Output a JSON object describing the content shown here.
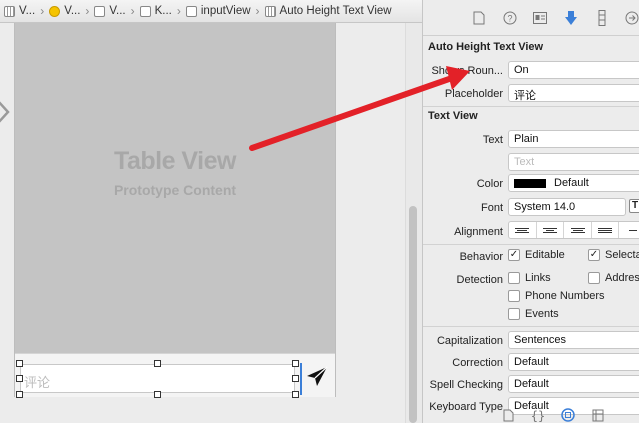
{
  "breadcrumbs": [
    {
      "label": "V...",
      "icon": "file-icon"
    },
    {
      "label": "V...",
      "icon": "yellow-circle-icon"
    },
    {
      "label": "V...",
      "icon": "view-icon"
    },
    {
      "label": "K...",
      "icon": "view-icon"
    },
    {
      "label": "inputView",
      "icon": "view-icon"
    },
    {
      "label": "Auto Height Text View",
      "icon": "textview-icon"
    }
  ],
  "canvas": {
    "table_title": "Table View",
    "table_subtitle": "Prototype Content",
    "input_placeholder": "评论"
  },
  "inspector": {
    "section1": {
      "title": "Auto Height Text View",
      "shows_round_label": "Shows Roun...",
      "shows_round_value": "On",
      "placeholder_label": "Placeholder",
      "placeholder_value": "评论"
    },
    "section2": {
      "title": "Text View",
      "text_label": "Text",
      "text_value": "Plain",
      "text_field_placeholder": "Text",
      "color_label": "Color",
      "color_value": "Default",
      "font_label": "Font",
      "font_value": "System 14.0",
      "alignment_label": "Alignment",
      "behavior_label": "Behavior",
      "editable_label": "Editable",
      "selectable_label": "Selecta",
      "detection_label": "Detection",
      "links_label": "Links",
      "address_label": "Addres",
      "phone_label": "Phone Numbers",
      "events_label": "Events",
      "capitalization_label": "Capitalization",
      "capitalization_value": "Sentences",
      "correction_label": "Correction",
      "correction_value": "Default",
      "spellcheck_label": "Spell Checking",
      "spellcheck_value": "Default",
      "keyboard_label": "Keyboard Type",
      "keyboard_value": "Default"
    }
  },
  "colors": {
    "arrow": "#e32128",
    "accent": "#3b7fd8",
    "table_bg": "#c4c4c4"
  }
}
